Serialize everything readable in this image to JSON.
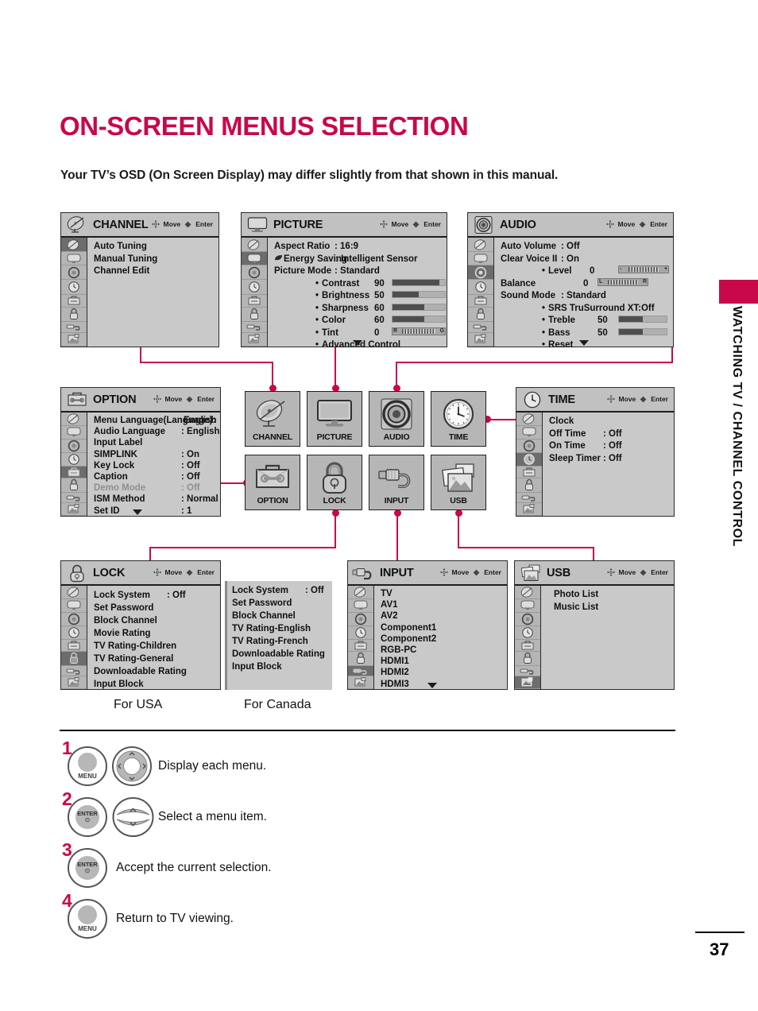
{
  "page": {
    "title": "ON-SCREEN MENUS SELECTION",
    "intro": "Your TV’s OSD (On Screen Display) may differ slightly from that shown in this manual.",
    "side_tab": "WATCHING TV / CHANNEL CONTROL",
    "page_number": "37"
  },
  "hint": {
    "move": "Move",
    "enter": "Enter"
  },
  "menus": {
    "channel": {
      "title": "CHANNEL",
      "icon": "satellite-dish-icon",
      "selected_rail_index": 0,
      "items": [
        {
          "label": "Auto Tuning",
          "value": ""
        },
        {
          "label": "Manual Tuning",
          "value": ""
        },
        {
          "label": "Channel Edit",
          "value": ""
        }
      ]
    },
    "picture": {
      "title": "PICTURE",
      "icon": "monitor-icon",
      "selected_rail_index": 1,
      "items": [
        {
          "label": "Aspect Ratio",
          "value": ": 16:9"
        },
        {
          "label": "Energy Saving",
          "value": ": Intelligent Sensor",
          "prefix_icon": "eco-leaf-icon"
        },
        {
          "label": "Picture Mode",
          "value": ": Standard"
        }
      ],
      "sub_items": [
        {
          "label": "Contrast",
          "value": "90",
          "bar": 90
        },
        {
          "label": "Brightness",
          "value": "50",
          "bar": 50
        },
        {
          "label": "Sharpness",
          "value": "60",
          "bar": 60
        },
        {
          "label": "Color",
          "value": "60",
          "bar": 60
        },
        {
          "label": "Tint",
          "value": "0",
          "tick": true,
          "tick_left": "R",
          "tick_right": "G"
        },
        {
          "label": "Advanced Control",
          "value": ""
        }
      ],
      "more_arrow": true
    },
    "audio": {
      "title": "AUDIO",
      "icon": "speaker-icon",
      "selected_rail_index": 2,
      "items": [
        {
          "label": "Auto Volume",
          "value": ": Off"
        },
        {
          "label": "Clear Voice II",
          "value": ": On"
        }
      ],
      "level": {
        "label": "Level",
        "value": "0",
        "tick_left": "-",
        "tick_right": "+"
      },
      "balance": {
        "label": "Balance",
        "value": "0",
        "tick_left": "L",
        "tick_right": "R"
      },
      "sound_mode": {
        "label": "Sound Mode",
        "value": ": Standard"
      },
      "sub_items": [
        {
          "label": "SRS TruSurround XT:Off",
          "value": ""
        },
        {
          "label": "Treble",
          "value": "50",
          "bar": 50
        },
        {
          "label": "Bass",
          "value": "50",
          "bar": 50
        },
        {
          "label": "Reset",
          "value": ""
        }
      ],
      "more_arrow": true
    },
    "option": {
      "title": "OPTION",
      "icon": "toolbox-icon",
      "selected_rail_index": 4,
      "items": [
        {
          "label": "Menu Language(Language):",
          "value": "English",
          "wide": true
        },
        {
          "label": "Audio Language",
          "value": ": English"
        },
        {
          "label": "Input Label",
          "value": ""
        },
        {
          "label": "SIMPLINK",
          "value": ": On"
        },
        {
          "label": "Key Lock",
          "value": ": Off"
        },
        {
          "label": "Caption",
          "value": ": Off"
        },
        {
          "label": "Demo Mode",
          "value": ": Off",
          "dimmed": true
        },
        {
          "label": "ISM Method",
          "value": ": Normal"
        },
        {
          "label": "Set ID",
          "value": ": 1"
        }
      ],
      "more_arrow": true
    },
    "time": {
      "title": "TIME",
      "icon": "clock-icon",
      "selected_rail_index": 3,
      "items": [
        {
          "label": "Clock",
          "value": ""
        },
        {
          "label": "Off Time",
          "value": ": Off"
        },
        {
          "label": "On Time",
          "value": ": Off"
        },
        {
          "label": "Sleep Timer",
          "value": ": Off"
        }
      ]
    },
    "lock": {
      "title": "LOCK",
      "icon": "padlock-icon",
      "selected_rail_index": 5,
      "items": [
        {
          "label": "Lock System",
          "value": ": Off"
        },
        {
          "label": "Set Password",
          "value": ""
        },
        {
          "label": "Block Channel",
          "value": ""
        },
        {
          "label": "Movie Rating",
          "value": ""
        },
        {
          "label": "TV Rating-Children",
          "value": ""
        },
        {
          "label": "TV Rating-General",
          "value": ""
        },
        {
          "label": "Downloadable Rating",
          "value": ""
        },
        {
          "label": "Input Block",
          "value": ""
        }
      ]
    },
    "lock_canada": {
      "items": [
        {
          "label": "Lock System",
          "value": ": Off"
        },
        {
          "label": "Set Password",
          "value": ""
        },
        {
          "label": "Block Channel",
          "value": ""
        },
        {
          "label": "TV Rating-English",
          "value": ""
        },
        {
          "label": "TV Rating-French",
          "value": ""
        },
        {
          "label": "Downloadable Rating",
          "value": ""
        },
        {
          "label": "Input Block",
          "value": ""
        }
      ]
    },
    "input": {
      "title": "INPUT",
      "icon": "plug-connector-icon",
      "selected_rail_index": 6,
      "items": [
        {
          "label": "TV",
          "value": ""
        },
        {
          "label": "AV1",
          "value": ""
        },
        {
          "label": "AV2",
          "value": ""
        },
        {
          "label": "Component1",
          "value": ""
        },
        {
          "label": "Component2",
          "value": ""
        },
        {
          "label": "RGB-PC",
          "value": ""
        },
        {
          "label": "HDMI1",
          "value": ""
        },
        {
          "label": "HDMI2",
          "value": ""
        },
        {
          "label": "HDMI3",
          "value": ""
        }
      ],
      "more_arrow": true
    },
    "usb": {
      "title": "USB",
      "icon": "photos-icon",
      "selected_rail_index": 7,
      "items": [
        {
          "label": "Photo List",
          "value": ""
        },
        {
          "label": "Music List",
          "value": ""
        }
      ]
    }
  },
  "tiles": [
    {
      "id": "channel",
      "label": "CHANNEL",
      "icon": "satellite-dish-icon"
    },
    {
      "id": "picture",
      "label": "PICTURE",
      "icon": "monitor-icon"
    },
    {
      "id": "audio",
      "label": "AUDIO",
      "icon": "speaker-icon"
    },
    {
      "id": "time",
      "label": "TIME",
      "icon": "clock-icon"
    },
    {
      "id": "option",
      "label": "OPTION",
      "icon": "toolbox-icon"
    },
    {
      "id": "lock",
      "label": "LOCK",
      "icon": "padlock-icon"
    },
    {
      "id": "input",
      "label": "INPUT",
      "icon": "plug-connector-icon"
    },
    {
      "id": "usb",
      "label": "USB",
      "icon": "photos-icon"
    }
  ],
  "captions": {
    "usa": "For USA",
    "canada": "For Canada"
  },
  "steps": [
    {
      "num": "1",
      "text": "Display each menu.",
      "buttons": [
        "MENU",
        "nav-wheel"
      ]
    },
    {
      "num": "2",
      "text": "Select a menu item.",
      "buttons": [
        "ENTER",
        "up-down-rocker"
      ]
    },
    {
      "num": "3",
      "text": "Accept the current selection.",
      "buttons": [
        "ENTER"
      ]
    },
    {
      "num": "4",
      "text": "Return to TV viewing.",
      "buttons": [
        "MENU"
      ]
    }
  ],
  "button_labels": {
    "menu": "MENU",
    "enter": "ENTER",
    "enter_mark": "⊙"
  },
  "colors": {
    "accent": "#c9074b",
    "osd_bg": "#c9c9c9",
    "osd_rail": "#b5b5b5",
    "osd_sel": "#6d6d6d"
  }
}
